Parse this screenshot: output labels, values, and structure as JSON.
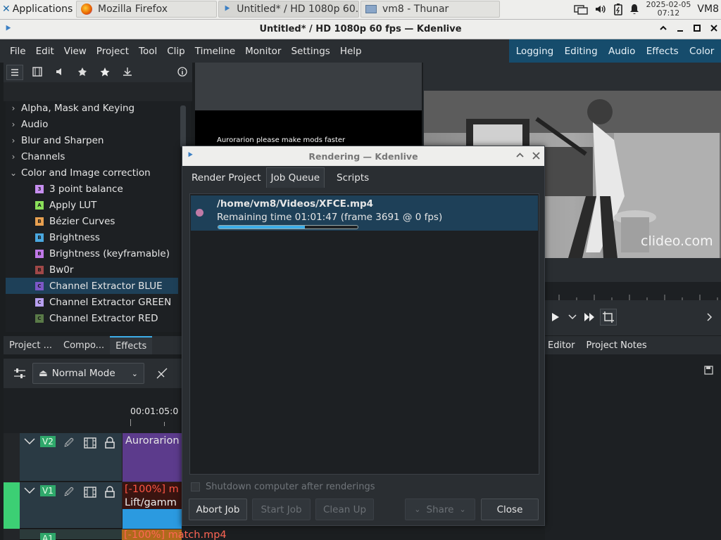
{
  "taskbar": {
    "applications_label": "Applications",
    "tasks": [
      {
        "label": "Mozilla Firefox"
      },
      {
        "label": "Untitled* / HD 1080p 60..."
      },
      {
        "label": "vm8 - Thunar"
      }
    ],
    "clock": {
      "date": "2025-02-05",
      "time": "07:12"
    },
    "user": "VM8"
  },
  "window": {
    "title": "Untitled* / HD 1080p 60 fps — Kdenlive"
  },
  "menubar": {
    "items": [
      "File",
      "Edit",
      "View",
      "Project",
      "Tool",
      "Clip",
      "Timeline",
      "Monitor",
      "Settings",
      "Help"
    ],
    "workspaces": [
      "Logging",
      "Editing",
      "Audio",
      "Effects",
      "Color"
    ]
  },
  "effects_tree": {
    "categories": [
      {
        "label": "Alpha, Mask and Keying"
      },
      {
        "label": "Audio"
      },
      {
        "label": "Blur and Sharpen"
      },
      {
        "label": "Channels"
      },
      {
        "label": "Color and Image correction"
      }
    ],
    "items": [
      {
        "label": "3 point balance",
        "badge": "3",
        "color": "#c78ff0"
      },
      {
        "label": "Apply LUT",
        "badge": "A",
        "color": "#8be05a"
      },
      {
        "label": "Bézier Curves",
        "badge": "B",
        "color": "#e8a050"
      },
      {
        "label": "Brightness",
        "badge": "B",
        "color": "#4aa8e0"
      },
      {
        "label": "Brightness (keyframable)",
        "badge": "B",
        "color": "#c078e8"
      },
      {
        "label": "Bw0r",
        "badge": "B",
        "color": "#a04848"
      },
      {
        "label": "Channel Extractor BLUE",
        "badge": "C",
        "color": "#7c58c8"
      },
      {
        "label": "Channel Extractor GREEN",
        "badge": "C",
        "color": "#b8a0f0"
      },
      {
        "label": "Channel Extractor RED",
        "badge": "C",
        "color": "#5a7a48"
      }
    ]
  },
  "left_tabs": [
    "Project ...",
    "Compo...",
    "Effects"
  ],
  "timeline": {
    "mode": "Normal Mode",
    "timecode": "00:01:05:0",
    "tracks": [
      {
        "name": "V2",
        "clip": "Aurorarion"
      },
      {
        "name": "V1",
        "clip": "[-100%] m",
        "clip_line2": "Lift/gamm"
      },
      {
        "name": "A1",
        "clip": "[-100%] match.mp4"
      }
    ]
  },
  "clip_monitor": {
    "subtitle": "Aurorarion please make mods faster"
  },
  "project_monitor": {
    "watermark": "clideo.com"
  },
  "right_tabs": [
    "Editor",
    "Project Notes"
  ],
  "dialog": {
    "title": "Rendering — Kdenlive",
    "tabs": [
      "Render Project",
      "Job Queue",
      "Scripts"
    ],
    "job": {
      "path": "/home/vm8/Videos/XFCE.mp4",
      "status": "Remaining time 01:01:47 (frame 3691 @ 0 fps)",
      "progress": 0.62
    },
    "shutdown_label": "Shutdown computer after renderings",
    "buttons": {
      "abort": "Abort Job",
      "start": "Start Job",
      "cleanup": "Clean Up",
      "share": "Share",
      "close": "Close"
    }
  }
}
